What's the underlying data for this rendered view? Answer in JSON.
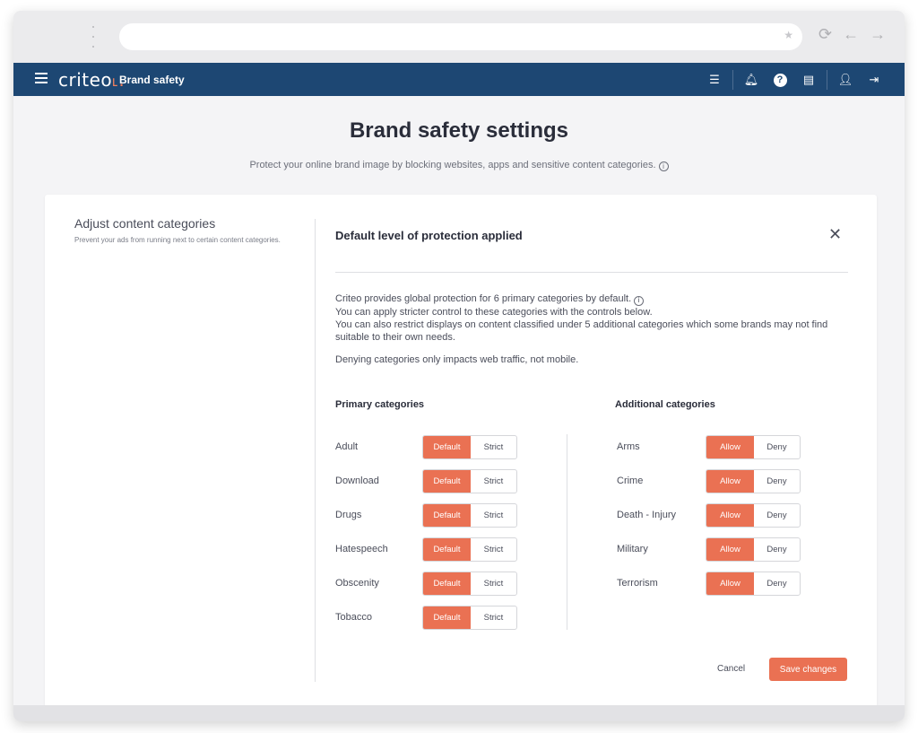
{
  "browser": {
    "icons": [
      "reload-icon",
      "back-arrow-icon",
      "forward-arrow-icon"
    ]
  },
  "topbar": {
    "logo": "criteo",
    "app_name": "Brand safety",
    "icons": [
      "list-icon",
      "bell-icon",
      "help-icon",
      "document-icon",
      "user-icon",
      "logout-icon"
    ],
    "help_glyph": "?"
  },
  "page": {
    "title": "Brand safety settings",
    "subtitle": "Protect your online brand image by blocking websites, apps and sensitive content categories."
  },
  "left": {
    "title": "Adjust content categories",
    "description": "Prevent your ads from running next to certain content categories."
  },
  "panel": {
    "title": "Default level of protection applied",
    "close": "✕",
    "desc_lines": [
      "Criteo provides global protection for 6 primary categories by default.",
      "You can apply stricter control to these categories with the controls below.",
      "You can also restrict displays on content classified under 5 additional categories which some brands may not find suitable to their own needs."
    ],
    "note": "Denying categories only impacts web traffic, not mobile.",
    "primary": {
      "heading": "Primary categories",
      "option_a": "Default",
      "option_b": "Strict",
      "items": [
        {
          "label": "Adult",
          "selected": "Default"
        },
        {
          "label": "Download",
          "selected": "Default"
        },
        {
          "label": "Drugs",
          "selected": "Default"
        },
        {
          "label": "Hatespeech",
          "selected": "Default"
        },
        {
          "label": "Obscenity",
          "selected": "Default"
        },
        {
          "label": "Tobacco",
          "selected": "Default"
        }
      ]
    },
    "additional": {
      "heading": "Additional categories",
      "option_a": "Allow",
      "option_b": "Deny",
      "items": [
        {
          "label": "Arms",
          "selected": "Allow"
        },
        {
          "label": "Crime",
          "selected": "Allow"
        },
        {
          "label": "Death - Injury",
          "selected": "Allow"
        },
        {
          "label": "Military",
          "selected": "Allow"
        },
        {
          "label": "Terrorism",
          "selected": "Allow"
        }
      ]
    },
    "cancel_label": "Cancel",
    "save_label": "Save changes"
  },
  "colors": {
    "topbar": "#1d4773",
    "accent": "#ea7153"
  }
}
